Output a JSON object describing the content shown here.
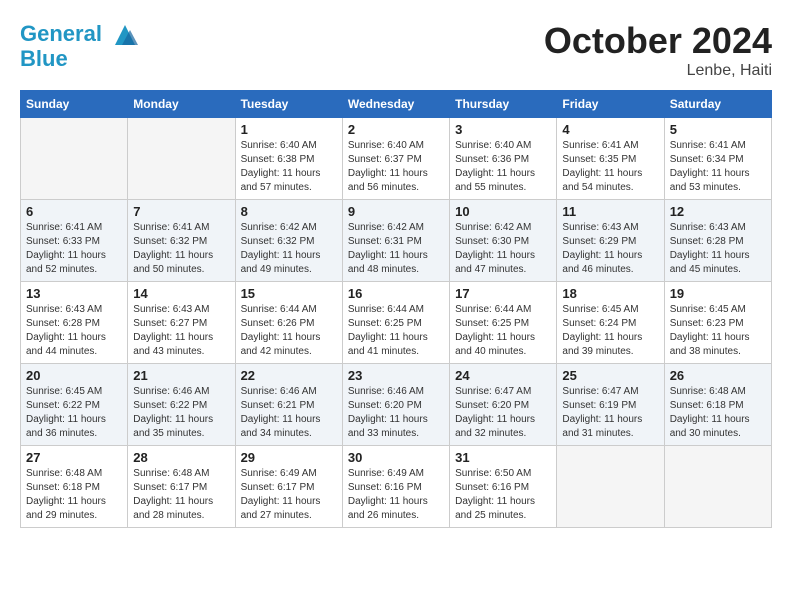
{
  "header": {
    "logo_line1": "General",
    "logo_line2": "Blue",
    "month_title": "October 2024",
    "location": "Lenbe, Haiti"
  },
  "weekdays": [
    "Sunday",
    "Monday",
    "Tuesday",
    "Wednesday",
    "Thursday",
    "Friday",
    "Saturday"
  ],
  "weeks": [
    [
      {
        "day": "",
        "empty": true
      },
      {
        "day": "",
        "empty": true
      },
      {
        "day": "1",
        "sunrise": "6:40 AM",
        "sunset": "6:38 PM",
        "daylight": "11 hours and 57 minutes."
      },
      {
        "day": "2",
        "sunrise": "6:40 AM",
        "sunset": "6:37 PM",
        "daylight": "11 hours and 56 minutes."
      },
      {
        "day": "3",
        "sunrise": "6:40 AM",
        "sunset": "6:36 PM",
        "daylight": "11 hours and 55 minutes."
      },
      {
        "day": "4",
        "sunrise": "6:41 AM",
        "sunset": "6:35 PM",
        "daylight": "11 hours and 54 minutes."
      },
      {
        "day": "5",
        "sunrise": "6:41 AM",
        "sunset": "6:34 PM",
        "daylight": "11 hours and 53 minutes."
      }
    ],
    [
      {
        "day": "6",
        "sunrise": "6:41 AM",
        "sunset": "6:33 PM",
        "daylight": "11 hours and 52 minutes."
      },
      {
        "day": "7",
        "sunrise": "6:41 AM",
        "sunset": "6:32 PM",
        "daylight": "11 hours and 50 minutes."
      },
      {
        "day": "8",
        "sunrise": "6:42 AM",
        "sunset": "6:32 PM",
        "daylight": "11 hours and 49 minutes."
      },
      {
        "day": "9",
        "sunrise": "6:42 AM",
        "sunset": "6:31 PM",
        "daylight": "11 hours and 48 minutes."
      },
      {
        "day": "10",
        "sunrise": "6:42 AM",
        "sunset": "6:30 PM",
        "daylight": "11 hours and 47 minutes."
      },
      {
        "day": "11",
        "sunrise": "6:43 AM",
        "sunset": "6:29 PM",
        "daylight": "11 hours and 46 minutes."
      },
      {
        "day": "12",
        "sunrise": "6:43 AM",
        "sunset": "6:28 PM",
        "daylight": "11 hours and 45 minutes."
      }
    ],
    [
      {
        "day": "13",
        "sunrise": "6:43 AM",
        "sunset": "6:28 PM",
        "daylight": "11 hours and 44 minutes."
      },
      {
        "day": "14",
        "sunrise": "6:43 AM",
        "sunset": "6:27 PM",
        "daylight": "11 hours and 43 minutes."
      },
      {
        "day": "15",
        "sunrise": "6:44 AM",
        "sunset": "6:26 PM",
        "daylight": "11 hours and 42 minutes."
      },
      {
        "day": "16",
        "sunrise": "6:44 AM",
        "sunset": "6:25 PM",
        "daylight": "11 hours and 41 minutes."
      },
      {
        "day": "17",
        "sunrise": "6:44 AM",
        "sunset": "6:25 PM",
        "daylight": "11 hours and 40 minutes."
      },
      {
        "day": "18",
        "sunrise": "6:45 AM",
        "sunset": "6:24 PM",
        "daylight": "11 hours and 39 minutes."
      },
      {
        "day": "19",
        "sunrise": "6:45 AM",
        "sunset": "6:23 PM",
        "daylight": "11 hours and 38 minutes."
      }
    ],
    [
      {
        "day": "20",
        "sunrise": "6:45 AM",
        "sunset": "6:22 PM",
        "daylight": "11 hours and 36 minutes."
      },
      {
        "day": "21",
        "sunrise": "6:46 AM",
        "sunset": "6:22 PM",
        "daylight": "11 hours and 35 minutes."
      },
      {
        "day": "22",
        "sunrise": "6:46 AM",
        "sunset": "6:21 PM",
        "daylight": "11 hours and 34 minutes."
      },
      {
        "day": "23",
        "sunrise": "6:46 AM",
        "sunset": "6:20 PM",
        "daylight": "11 hours and 33 minutes."
      },
      {
        "day": "24",
        "sunrise": "6:47 AM",
        "sunset": "6:20 PM",
        "daylight": "11 hours and 32 minutes."
      },
      {
        "day": "25",
        "sunrise": "6:47 AM",
        "sunset": "6:19 PM",
        "daylight": "11 hours and 31 minutes."
      },
      {
        "day": "26",
        "sunrise": "6:48 AM",
        "sunset": "6:18 PM",
        "daylight": "11 hours and 30 minutes."
      }
    ],
    [
      {
        "day": "27",
        "sunrise": "6:48 AM",
        "sunset": "6:18 PM",
        "daylight": "11 hours and 29 minutes."
      },
      {
        "day": "28",
        "sunrise": "6:48 AM",
        "sunset": "6:17 PM",
        "daylight": "11 hours and 28 minutes."
      },
      {
        "day": "29",
        "sunrise": "6:49 AM",
        "sunset": "6:17 PM",
        "daylight": "11 hours and 27 minutes."
      },
      {
        "day": "30",
        "sunrise": "6:49 AM",
        "sunset": "6:16 PM",
        "daylight": "11 hours and 26 minutes."
      },
      {
        "day": "31",
        "sunrise": "6:50 AM",
        "sunset": "6:16 PM",
        "daylight": "11 hours and 25 minutes."
      },
      {
        "day": "",
        "empty": true
      },
      {
        "day": "",
        "empty": true
      }
    ]
  ]
}
